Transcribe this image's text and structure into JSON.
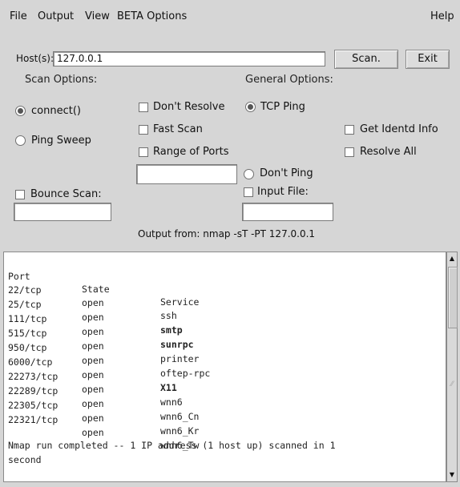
{
  "menu": {
    "file": "File",
    "output": "Output",
    "view": "View",
    "beta": "BETA Options",
    "help": "Help"
  },
  "host": {
    "label": "Host(s):",
    "value": "127.0.0.1"
  },
  "buttons": {
    "scan": "Scan.",
    "exit": "Exit"
  },
  "scan_options": {
    "title": "Scan Options:",
    "connect": "connect()",
    "ping_sweep": "Ping Sweep",
    "bounce_scan": "Bounce Scan:",
    "bounce_value": ""
  },
  "general_options": {
    "title": "General Options:",
    "dont_resolve": "Don't Resolve",
    "tcp_ping": "TCP Ping",
    "fast_scan": "Fast Scan",
    "range_of_ports": "Range of Ports",
    "range_value": "",
    "dont_ping": "Don't Ping",
    "input_file": "Input File:",
    "input_file_value": "",
    "get_identd": "Get Identd Info",
    "resolve_all": "Resolve All"
  },
  "output_from": "Output from: nmap -sT -PT 127.0.0.1",
  "results": {
    "headers": [
      "Port",
      "State",
      "Service"
    ],
    "rows": [
      {
        "port": "22/tcp",
        "state": "open",
        "service": "ssh"
      },
      {
        "port": "25/tcp",
        "state": "open",
        "service": "smtp"
      },
      {
        "port": "111/tcp",
        "state": "open",
        "service": "sunrpc"
      },
      {
        "port": "515/tcp",
        "state": "open",
        "service": "printer"
      },
      {
        "port": "950/tcp",
        "state": "open",
        "service": "oftep-rpc"
      },
      {
        "port": "6000/tcp",
        "state": "open",
        "service": "X11"
      },
      {
        "port": "22273/tcp",
        "state": "open",
        "service": "wnn6"
      },
      {
        "port": "22289/tcp",
        "state": "open",
        "service": "wnn6_Cn"
      },
      {
        "port": "22305/tcp",
        "state": "open",
        "service": "wnn6_Kr"
      },
      {
        "port": "22321/tcp",
        "state": "open",
        "service": "wnn6_Tw"
      }
    ],
    "summary_line1": "Nmap run completed -- 1 IP address (1 host up) scanned in 1",
    "summary_line2": "second"
  }
}
